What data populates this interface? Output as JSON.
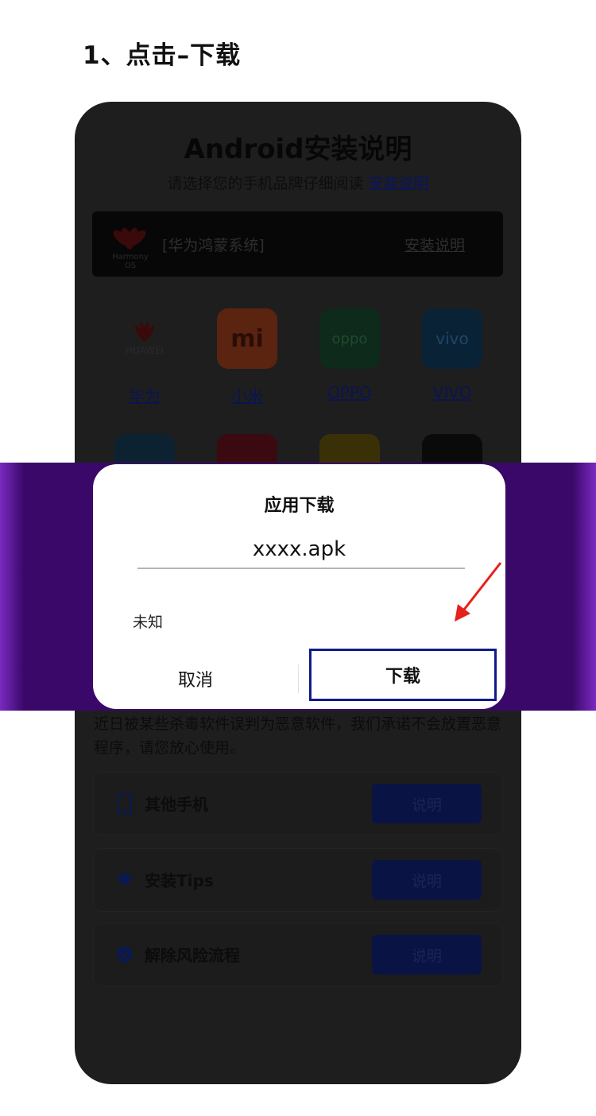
{
  "step_title": "1、点击–下载",
  "phone": {
    "title": "Android安装说明",
    "subtitle": "请选择您的手机品牌仔细阅读",
    "subtitle_link": "安装说明",
    "harmony": {
      "logo_line1": "Harmony",
      "logo_line2": "OS",
      "name": "[华为鸿蒙系统]",
      "link": "安装说明"
    },
    "brands": [
      {
        "label": "华为",
        "icon_text": "HUAWEI",
        "icon": "huawei-logo-icon",
        "color": "#1e1e1e"
      },
      {
        "label": "小米",
        "icon_text": "mi",
        "icon": "xiaomi-logo-icon",
        "color": "#5a2410"
      },
      {
        "label": "OPPO",
        "icon_text": "oppo",
        "icon": "oppo-logo-icon",
        "color": "#0d2a1a"
      },
      {
        "label": "VIVO",
        "icon_text": "vivo",
        "icon": "vivo-logo-icon",
        "color": "#0a2236"
      }
    ],
    "brands_row2_colors": [
      "#0c2230",
      "#3a0a10",
      "#3a3008",
      "#0a0a0a"
    ],
    "notice": "近日被某些杀毒软件误判为恶意软件，我们承诺不会放置恶意程序，请您放心使用。",
    "cards": [
      {
        "label": "其他手机",
        "button": "说明",
        "icon": "phone-icon"
      },
      {
        "label": "安装Tips",
        "button": "说明",
        "icon": "lightbulb-icon"
      },
      {
        "label": "解除风险流程",
        "button": "说明",
        "icon": "shield-check-icon"
      }
    ]
  },
  "dialog": {
    "title": "应用下载",
    "filename": "xxxx.apk",
    "size": "未知",
    "cancel_label": "取消",
    "download_label": "下载"
  },
  "colors": {
    "overlay": "#3a0868",
    "highlight_border": "#111a8c",
    "arrow": "#e8201c"
  }
}
